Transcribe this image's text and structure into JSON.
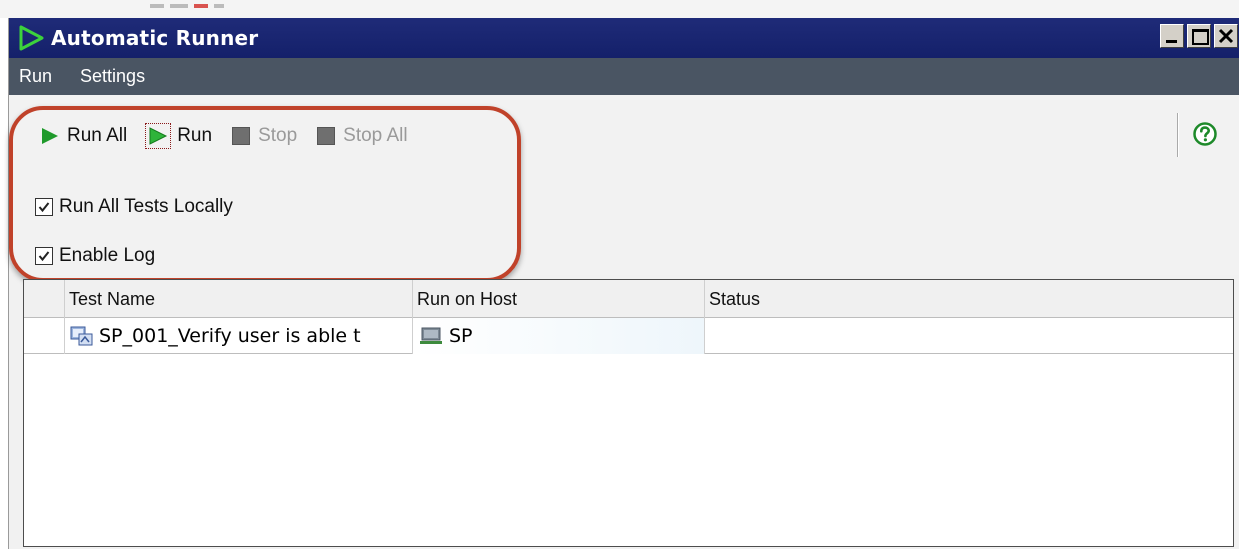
{
  "window": {
    "title": "Automatic Runner",
    "title_bar_color": "#14206a",
    "controls": [
      "minimize-icon",
      "maximize-icon",
      "close-icon"
    ]
  },
  "menu": {
    "items": [
      {
        "label": "Run"
      },
      {
        "label": "Settings"
      }
    ]
  },
  "toolbar": {
    "run_all_label": "Run All",
    "run_label": "Run",
    "stop_label": "Stop",
    "stop_all_label": "Stop All",
    "help_icon": "help-icon"
  },
  "options": {
    "run_all_tests_locally": {
      "label": "Run All Tests Locally",
      "checked": true
    },
    "enable_log": {
      "label": "Enable Log",
      "checked": true
    }
  },
  "highlight_color": "#c0422a",
  "table": {
    "columns": [
      "Test Name",
      "Run on Host",
      "Status"
    ],
    "rows": [
      {
        "test_name": "SP_001_Verify user is able t",
        "host": "SP",
        "status": ""
      }
    ]
  }
}
